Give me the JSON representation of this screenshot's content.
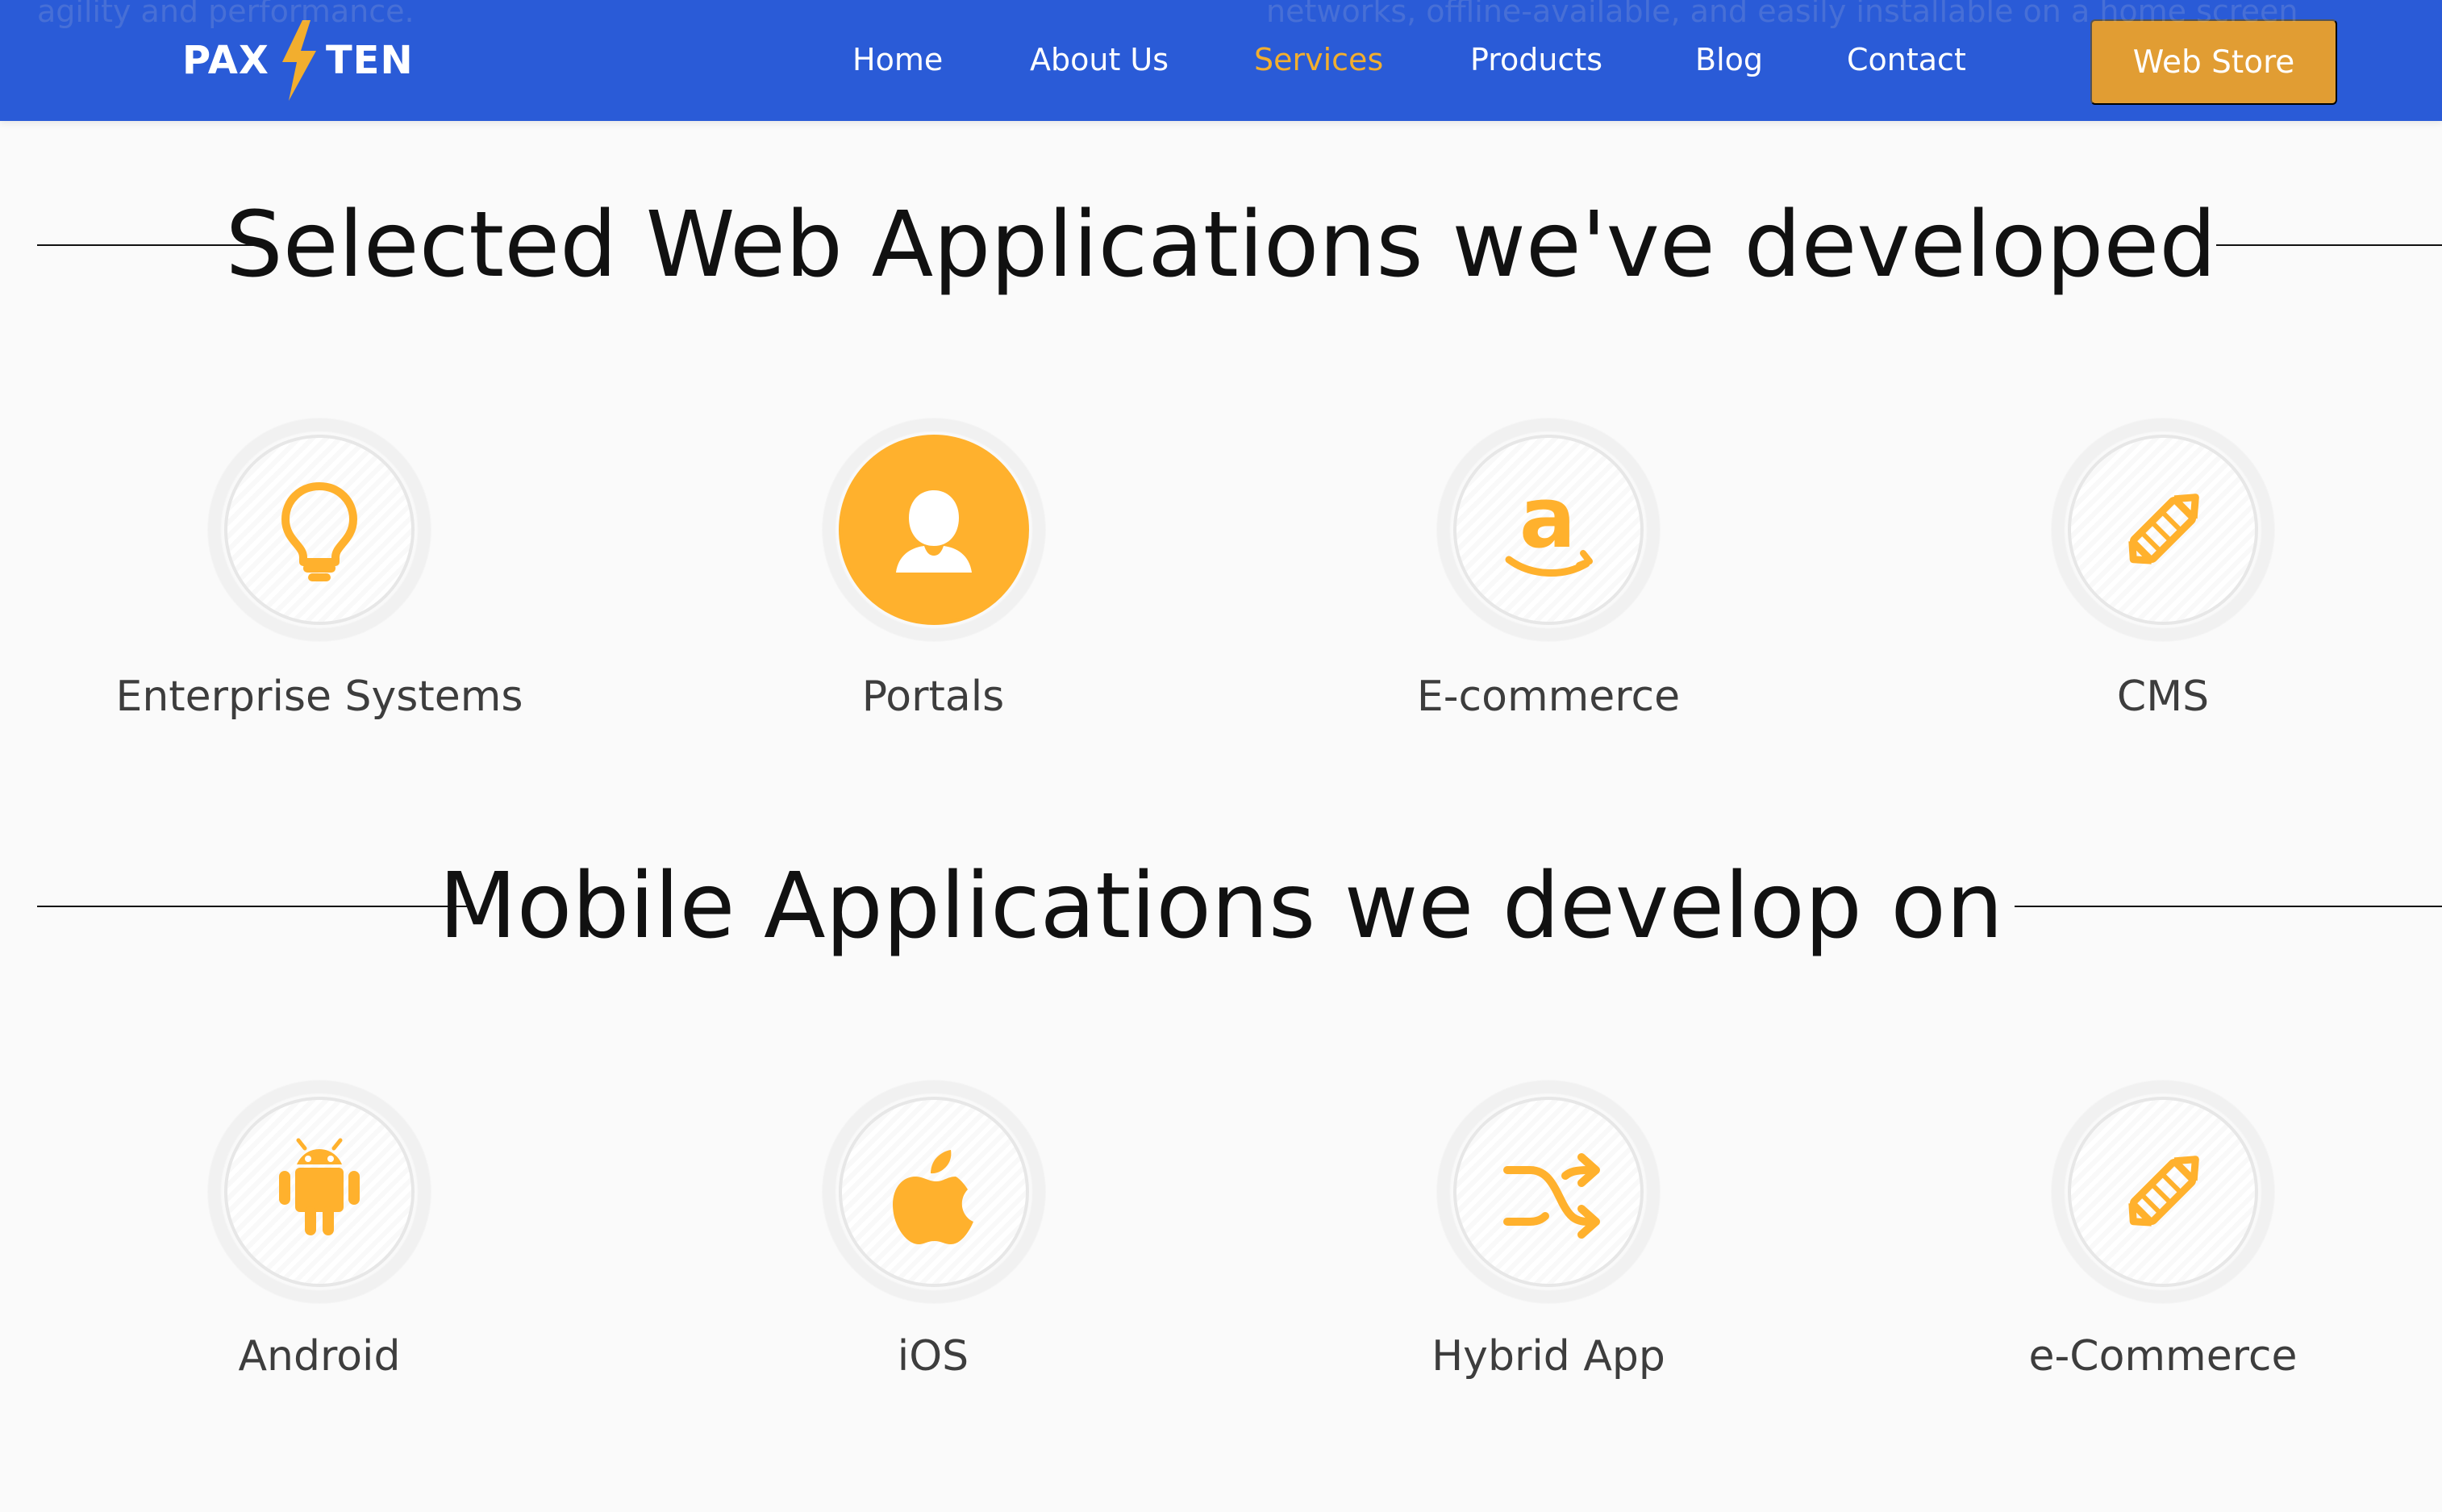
{
  "background_text": {
    "left": "agility and performance.",
    "right": "networks, offline-available, and easily installable on a home screen"
  },
  "header": {
    "logo_left": "PAX",
    "logo_right": "TEN",
    "nav": {
      "home": "Home",
      "about": "About Us",
      "services": "Services",
      "products": "Products",
      "blog": "Blog",
      "contact": "Contact"
    },
    "cta": "Web Store"
  },
  "sections": {
    "web": {
      "title": "Selected Web Applications we've developed",
      "items": [
        {
          "label": "Enterprise Systems",
          "icon": "lightbulb-icon"
        },
        {
          "label": "Portals",
          "icon": "user-icon"
        },
        {
          "label": "E-commerce",
          "icon": "amazon-icon"
        },
        {
          "label": "CMS",
          "icon": "pencil-icon"
        }
      ]
    },
    "mobile": {
      "title": "Mobile Applications we develop on",
      "items": [
        {
          "label": "Android",
          "icon": "android-icon"
        },
        {
          "label": "iOS",
          "icon": "apple-icon"
        },
        {
          "label": "Hybrid App",
          "icon": "shuffle-icon"
        },
        {
          "label": "e-Commerce",
          "icon": "pencil-icon"
        }
      ]
    }
  },
  "colors": {
    "nav_bg": "#2a5bd7",
    "accent": "#ffb12d",
    "button": "#e19d33",
    "active_nav": "#f2ae2e"
  }
}
